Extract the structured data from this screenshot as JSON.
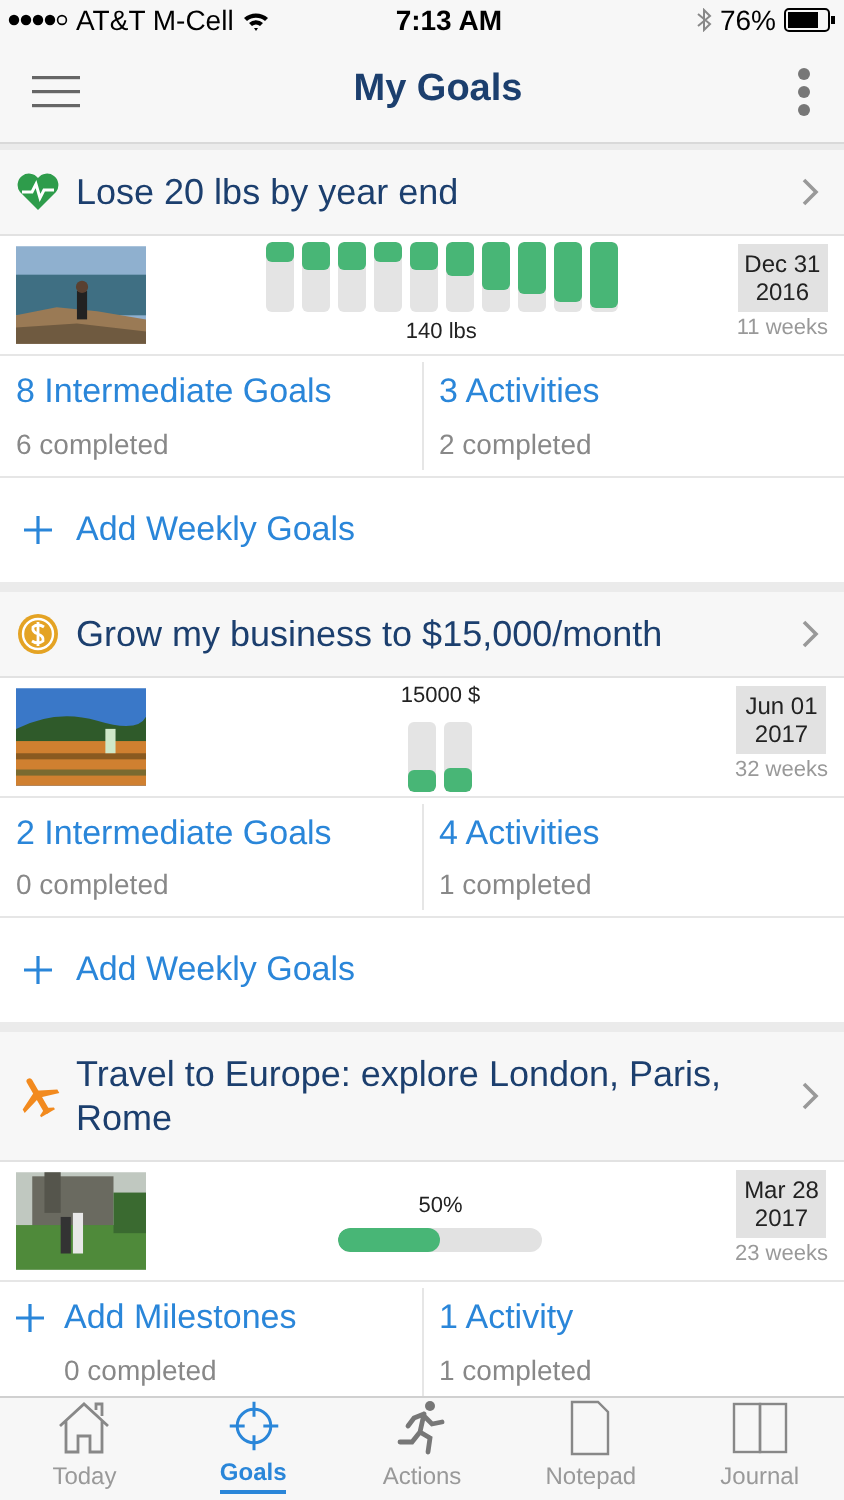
{
  "status_bar": {
    "carrier": "AT&T M-Cell",
    "time": "7:13 AM",
    "battery": "76%"
  },
  "nav": {
    "title": "My Goals"
  },
  "goals": [
    {
      "title": "Lose 20 lbs by year end",
      "progress": {
        "kind": "bars",
        "label": "140 lbs",
        "bars": [
          {
            "level": 0.3
          },
          {
            "level": 0.4
          },
          {
            "level": 0.4
          },
          {
            "level": 0.3
          },
          {
            "level": 0.4
          },
          {
            "level": 0.5
          },
          {
            "level": 0.7
          },
          {
            "level": 0.75
          },
          {
            "level": 0.85
          },
          {
            "level": 0.95
          }
        ]
      },
      "date": "Dec 31",
      "year": "2016",
      "weeks": "11 weeks",
      "left": {
        "kind": "count",
        "title": "8 Intermediate Goals",
        "sub": "6 completed"
      },
      "right": {
        "title": "3 Activities",
        "sub": "2 completed"
      },
      "add": "Add Weekly Goals"
    },
    {
      "title": "Grow my business to $15,000/month",
      "progress": {
        "kind": "bars",
        "label": "15000 $",
        "bars": [
          {
            "level": 0.3
          },
          {
            "level": 0.35
          }
        ]
      },
      "date": "Jun 01",
      "year": "2017",
      "weeks": "32 weeks",
      "left": {
        "kind": "count",
        "title": "2 Intermediate Goals",
        "sub": "0 completed"
      },
      "right": {
        "title": "4 Activities",
        "sub": "1 completed"
      },
      "add": "Add Weekly Goals"
    },
    {
      "title": "Travel to Europe: explore London, Paris, Rome",
      "progress": {
        "kind": "bar",
        "label": "50%",
        "level": 0.5
      },
      "date": "Mar 28",
      "year": "2017",
      "weeks": "23 weeks",
      "left": {
        "kind": "add",
        "title": "Add Milestones",
        "sub": "0 completed"
      },
      "right": {
        "title": "1 Activity",
        "sub": "1 completed"
      }
    }
  ],
  "tabs": [
    {
      "label": "Today",
      "selected": false
    },
    {
      "label": "Goals",
      "selected": true
    },
    {
      "label": "Actions",
      "selected": false
    },
    {
      "label": "Notepad",
      "selected": false
    },
    {
      "label": "Journal",
      "selected": false
    }
  ]
}
